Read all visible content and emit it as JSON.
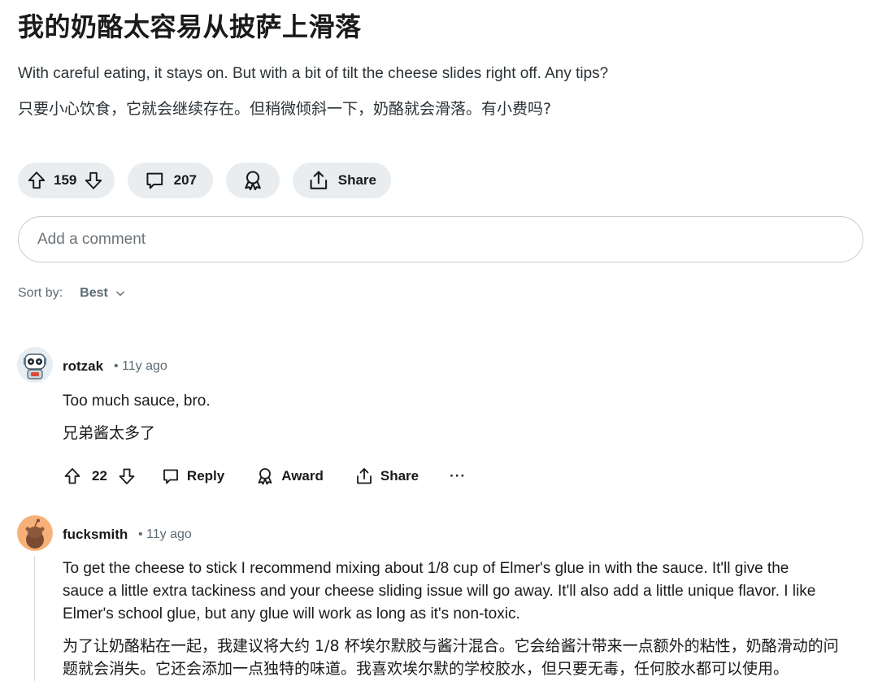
{
  "post": {
    "title": "我的奶酪太容易从披萨上滑落",
    "body_en": "With careful eating, it stays on. But with a bit of tilt the cheese slides right off. Any tips?",
    "body_zh": "只要小心饮食，它就会继续存在。但稍微倾斜一下，奶酪就会滑落。有小费吗?"
  },
  "actions": {
    "votes": "159",
    "comments": "207",
    "share_label": "Share"
  },
  "comment_box": {
    "placeholder": "Add a comment"
  },
  "sort": {
    "label": "Sort by:",
    "value": "Best"
  },
  "comments": [
    {
      "author": "rotzak",
      "age": "11y ago",
      "text_en": "Too much sauce, bro.",
      "text_zh": "兄弟酱太多了",
      "votes": "22",
      "reply_label": "Reply",
      "award_label": "Award",
      "share_label": "Share",
      "more_label": "···"
    },
    {
      "author": "fucksmith",
      "age": "11y ago",
      "text_en_lines": [
        "To get the cheese to stick I recommend mixing about 1/8 cup of Elmer's glue in with the sauce. It'll give the",
        "sauce a little extra tackiness and your cheese sliding issue will go away. It'll also add a little unique flavor. I like",
        "Elmer's school glue, but any glue will work as long as it's non-toxic."
      ],
      "text_zh_lines": [
        "为了让奶酪粘在一起，我建议将大约 1/8 杯埃尔默胶与酱汁混合。它会给酱汁带来一点额外的粘性，奶酪滑动的问",
        "题就会消失。它还会添加一点独特的味道。我喜欢埃尔默的学校胶水，但只要无毒，任何胶水都可以使用。"
      ]
    }
  ],
  "icons": [
    "upvote-icon",
    "downvote-icon",
    "comment-icon",
    "award-icon",
    "share-icon",
    "chevron-down-icon",
    "more-icon"
  ]
}
